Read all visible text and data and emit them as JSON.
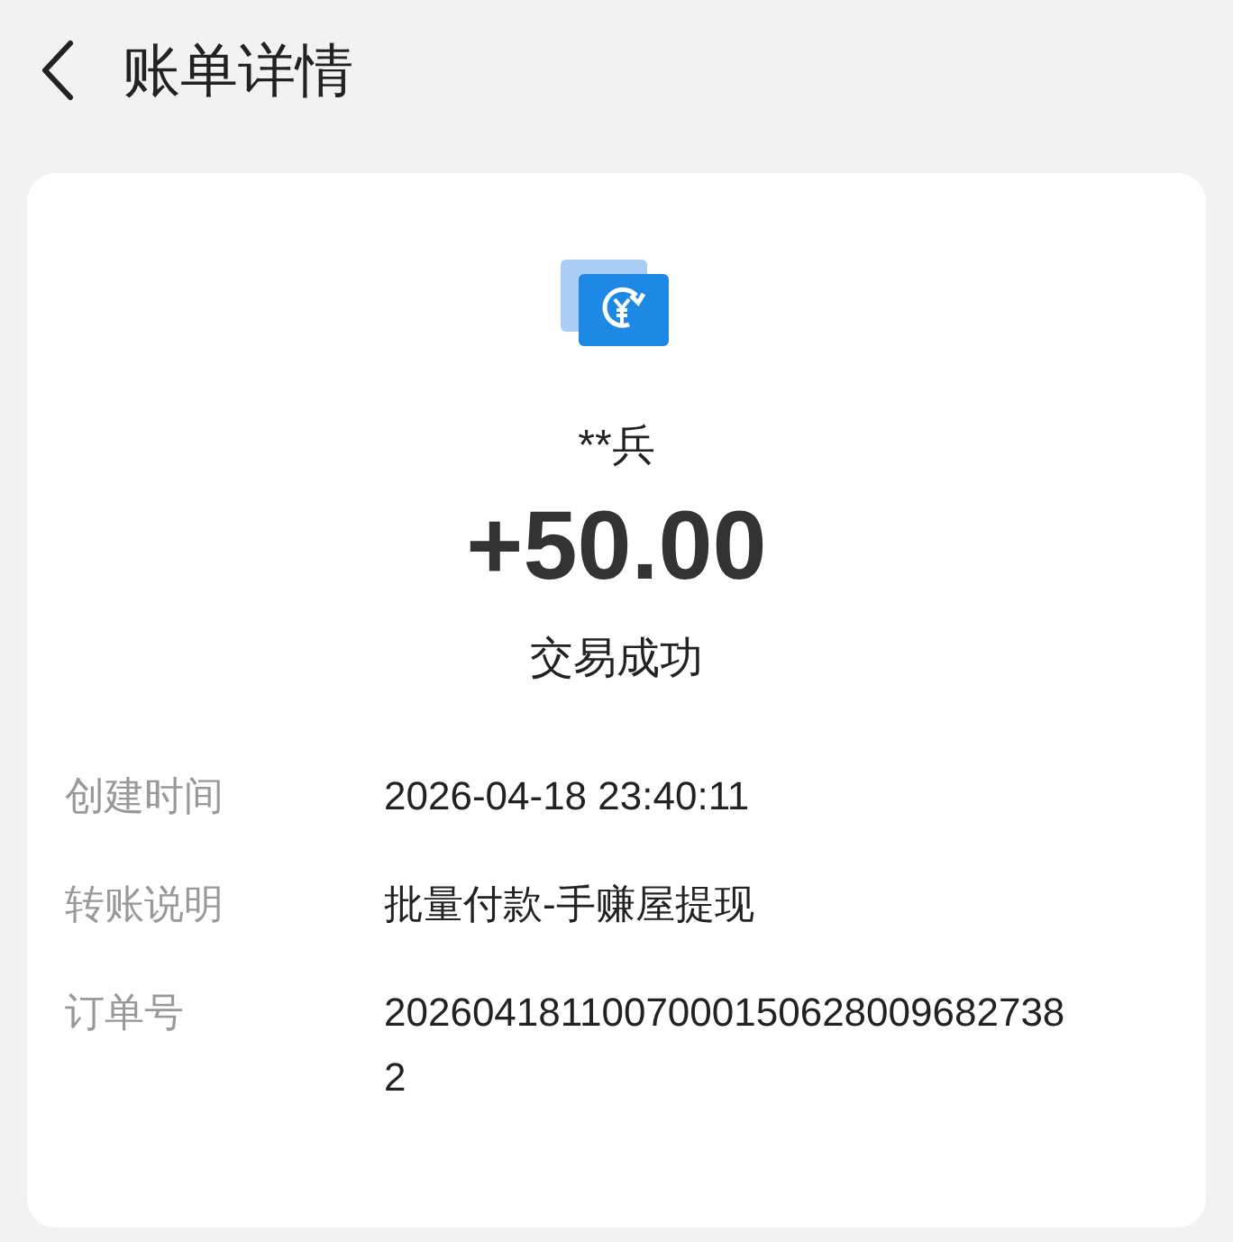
{
  "header": {
    "title": "账单详情"
  },
  "summary": {
    "counterparty": "**兵",
    "amount": "+50.00",
    "status": "交易成功"
  },
  "details": [
    {
      "label": "创建时间",
      "value": "2026-04-18 23:40:11"
    },
    {
      "label": "转账说明",
      "value": "批量付款-手赚屋提现"
    },
    {
      "label": "订单号",
      "value": "20260418110070001506280096827382"
    }
  ]
}
